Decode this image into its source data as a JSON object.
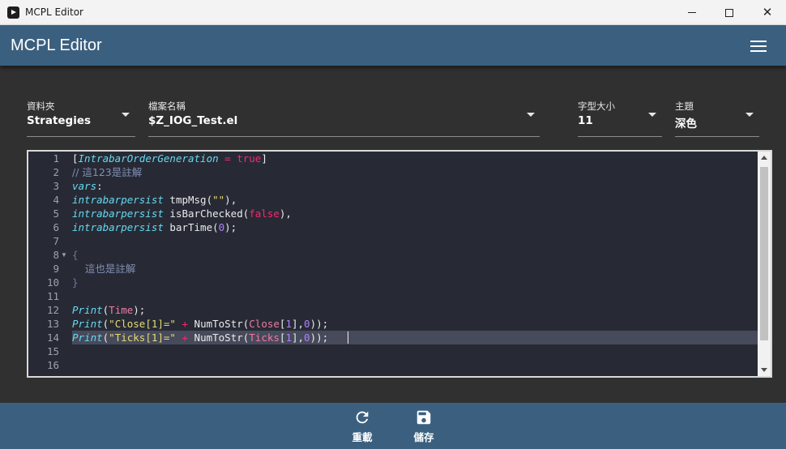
{
  "window": {
    "title": "MCPL Editor",
    "minimize_glyph": "",
    "close_glyph": "✕"
  },
  "appbar": {
    "title": "MCPL Editor",
    "menu_icon": "hamburger-menu-icon"
  },
  "fields": {
    "folder": {
      "label": "資料夾",
      "value": "Strategies"
    },
    "filename": {
      "label": "檔案名稱",
      "value": "$Z_IOG_Test.el"
    },
    "font_size": {
      "label": "字型大小",
      "value": "11"
    },
    "theme": {
      "label": "主題",
      "value": "深色"
    }
  },
  "editor": {
    "line_numbers": [
      "1",
      "2",
      "3",
      "4",
      "5",
      "6",
      "7",
      "8",
      "9",
      "10",
      "11",
      "12",
      "13",
      "14",
      "15",
      "16"
    ],
    "highlighted_line": "14",
    "lines": {
      "l1": {
        "open": "[",
        "attr": "IntrabarOrderGeneration",
        "eq": " = ",
        "val": "true",
        "close": "]"
      },
      "l2": {
        "comment": "// 這123是註解"
      },
      "l3": {
        "kw": "vars",
        "rest": ":"
      },
      "l4": {
        "kw": "intrabarpersist",
        "name": " tmpMsg(",
        "str": "\"\"",
        "end": "),"
      },
      "l5": {
        "kw": "intrabarpersist",
        "name": " isBarChecked(",
        "val": "false",
        "end": "),"
      },
      "l6": {
        "kw": "intrabarpersist",
        "name": " barTime(",
        "num": "0",
        "end": ");"
      },
      "l8": {
        "brace": "{"
      },
      "l9": {
        "comment": "    這也是註解"
      },
      "l10": {
        "brace": "}"
      },
      "l12": {
        "fn": "Print",
        "open": "(",
        "arg": "Time",
        "end": ");"
      },
      "l13": {
        "fn": "Print",
        "open": "(",
        "str": "\"Close[1]=\"",
        "plus": " + ",
        "call": "NumToStr(",
        "arg": "Close",
        "idx_open": "[",
        "idx": "1",
        "idx_close": "],",
        "num": "0",
        "end": "));"
      },
      "l14": {
        "fn": "Print",
        "open": "(",
        "str": "\"Ticks[1]=\"",
        "plus": " + ",
        "call": "NumToStr(",
        "arg": "Ticks",
        "idx_open": "[",
        "idx": "1",
        "idx_close": "],",
        "num": "0",
        "end": "));"
      }
    }
  },
  "actions": {
    "reload": {
      "label": "重載",
      "icon": "refresh-icon"
    },
    "save": {
      "label": "儲存",
      "icon": "save-icon"
    }
  },
  "colors": {
    "appbar": "#3b607f",
    "background": "#303030",
    "editor_bg": "#272a35",
    "keyword": "#66d9ef",
    "string": "#e6db74",
    "number": "#ae81ff",
    "boolean": "#f92672",
    "comment": "#6a7a9e"
  }
}
